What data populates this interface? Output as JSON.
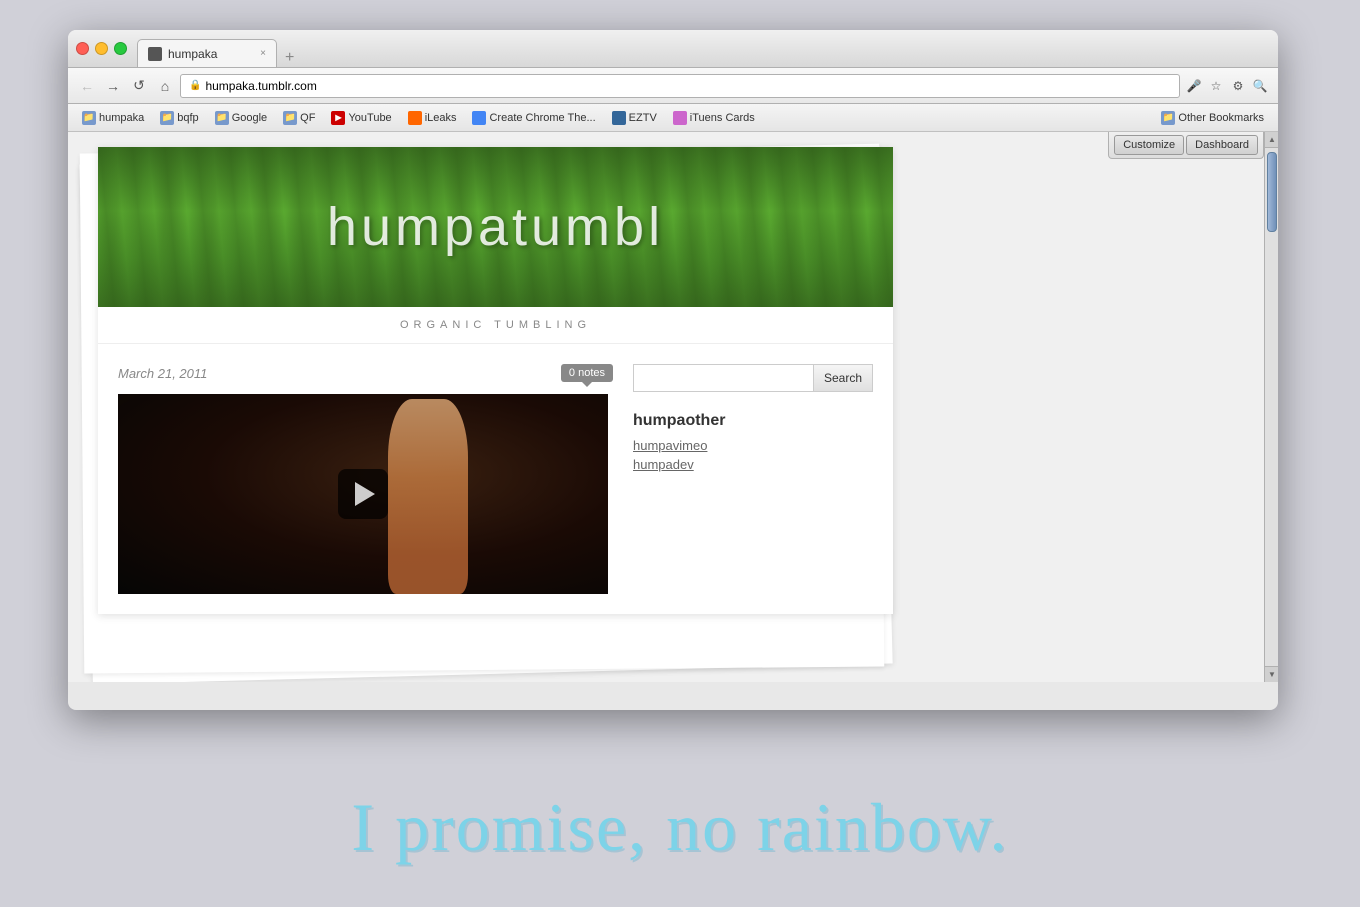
{
  "browser": {
    "tab_label": "humpaka",
    "tab_close": "×",
    "tab_new": "+",
    "url": "humpaka.tumblr.com",
    "url_display": "humpaka.tumblr.com",
    "nav_back": "←",
    "nav_forward": "→",
    "nav_reload": "↺",
    "nav_home": "⌂"
  },
  "bookmarks": [
    {
      "label": "humpaka",
      "type": "folder"
    },
    {
      "label": "bqfp",
      "type": "folder"
    },
    {
      "label": "Google",
      "type": "folder"
    },
    {
      "label": "QF",
      "type": "folder"
    },
    {
      "label": "YouTube",
      "type": "youtube"
    },
    {
      "label": "iLeaks",
      "type": "ileaks"
    },
    {
      "label": "Create Chrome The...",
      "type": "chrome"
    },
    {
      "label": "EZTV",
      "type": "eztv"
    },
    {
      "label": "iTuens Cards",
      "type": "itunes"
    },
    {
      "label": "Other Bookmarks",
      "type": "other"
    }
  ],
  "toolbar": {
    "customize_label": "Customize",
    "dashboard_label": "Dashboard"
  },
  "site": {
    "title": "humpatumbl",
    "subtitle": "ORGANIC TUMBLING",
    "post_date": "March 21, 2011",
    "notes_count": "0 notes",
    "search_placeholder": "",
    "search_button": "Search",
    "sidebar_heading": "humpaother",
    "sidebar_links": [
      "humpavimeo",
      "humpadev"
    ]
  },
  "bottom_text": "I promise, no rainbow."
}
